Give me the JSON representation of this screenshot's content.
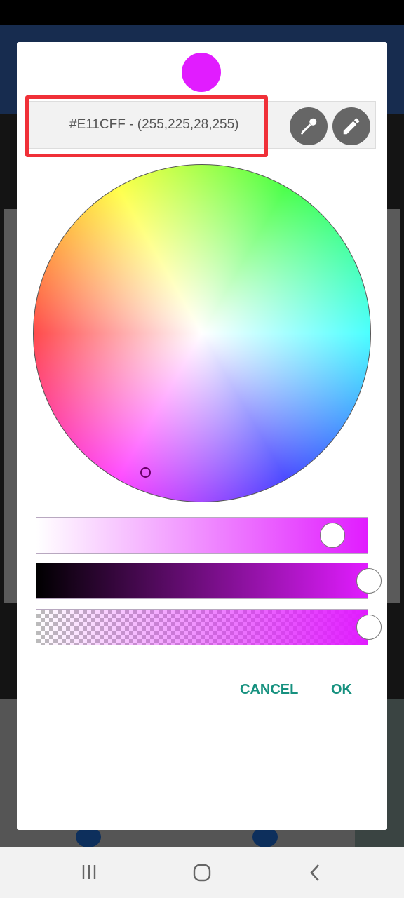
{
  "dialog": {
    "selected_color": "#E11CFF",
    "color_text": "#E11CFF - (255,225,28,255)",
    "eyedropper_icon": "eyedropper-icon",
    "edit_icon": "pencil-icon",
    "saturation": 0.89,
    "value": 1.0,
    "alpha": 1.0,
    "cancel_label": "CANCEL",
    "ok_label": "OK",
    "accent_color": "#16917F",
    "highlight_color": "#F03038"
  },
  "navbar": {
    "recents_icon": "recents-icon",
    "home_icon": "home-icon",
    "back_icon": "back-icon"
  }
}
